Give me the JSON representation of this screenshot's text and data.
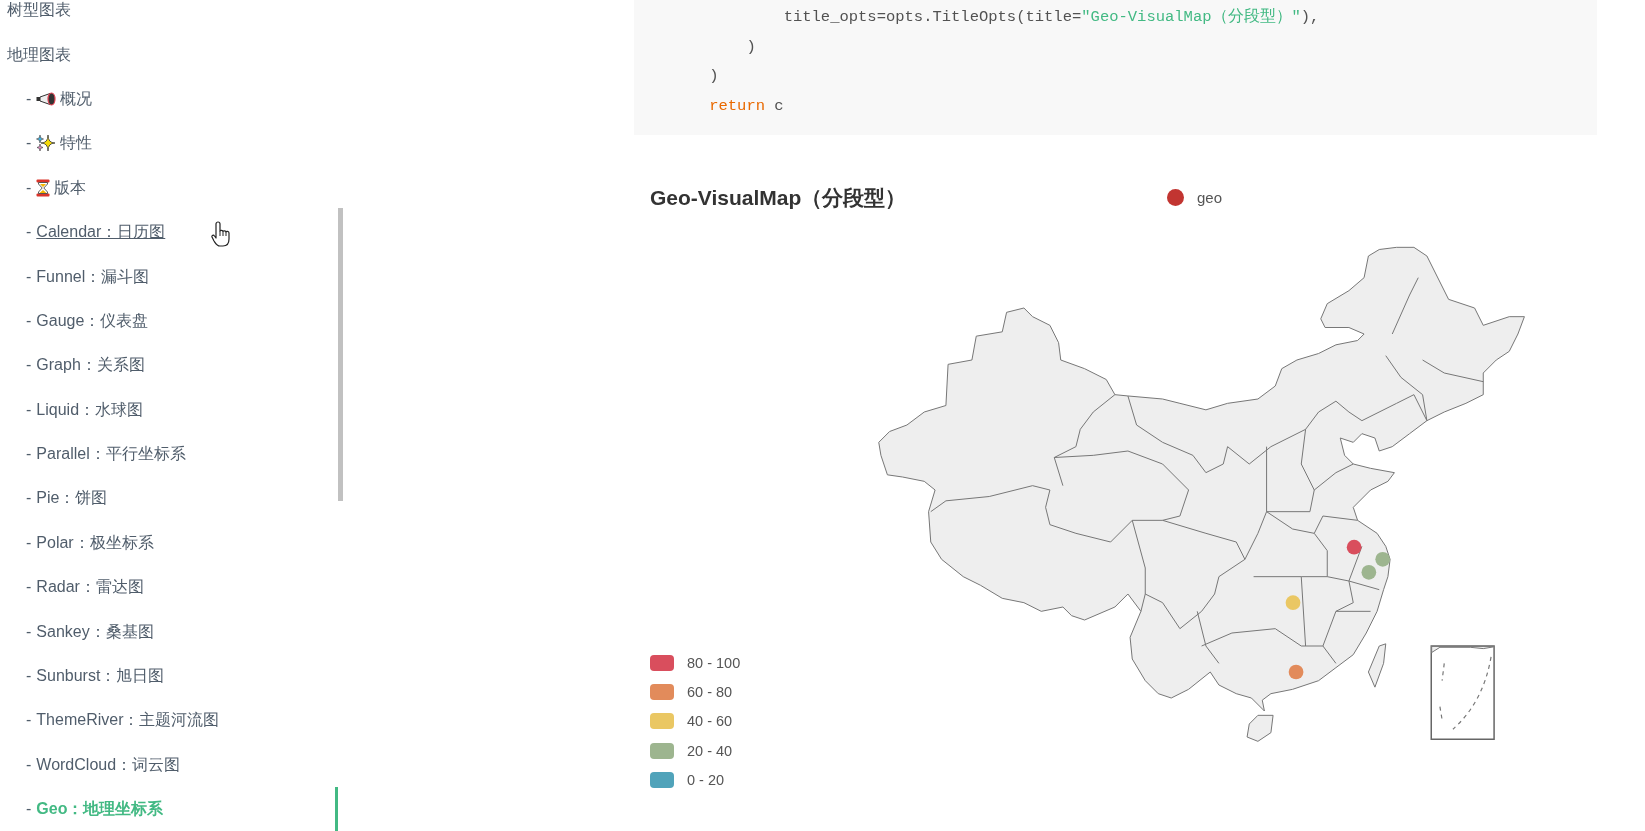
{
  "sidebar": {
    "sections": [
      {
        "title": "树型图表"
      },
      {
        "title": "地理图表",
        "children": [
          {
            "kind": "megaphone",
            "bullet": "-",
            "label": "概况",
            "hovered": false,
            "selected": false
          },
          {
            "kind": "sparkles",
            "bullet": "-",
            "label": "特性",
            "hovered": false,
            "selected": false
          },
          {
            "kind": "hourglass",
            "bullet": "-",
            "label": "版本",
            "hovered": false,
            "selected": false
          },
          {
            "kind": "text",
            "bullet": "-",
            "label": "Calendar：日历图",
            "hovered": true,
            "selected": false
          },
          {
            "kind": "text",
            "bullet": "-",
            "label": "Funnel：漏斗图",
            "hovered": false,
            "selected": false
          },
          {
            "kind": "text",
            "bullet": "-",
            "label": "Gauge：仪表盘",
            "hovered": false,
            "selected": false
          },
          {
            "kind": "text",
            "bullet": "-",
            "label": "Graph：关系图",
            "hovered": false,
            "selected": false
          },
          {
            "kind": "text",
            "bullet": "-",
            "label": "Liquid：水球图",
            "hovered": false,
            "selected": false
          },
          {
            "kind": "text",
            "bullet": "-",
            "label": "Parallel：平行坐标系",
            "hovered": false,
            "selected": false
          },
          {
            "kind": "text",
            "bullet": "-",
            "label": "Pie：饼图",
            "hovered": false,
            "selected": false
          },
          {
            "kind": "text",
            "bullet": "-",
            "label": "Polar：极坐标系",
            "hovered": false,
            "selected": false
          },
          {
            "kind": "text",
            "bullet": "-",
            "label": "Radar：雷达图",
            "hovered": false,
            "selected": false
          },
          {
            "kind": "text",
            "bullet": "-",
            "label": "Sankey：桑基图",
            "hovered": false,
            "selected": false
          },
          {
            "kind": "text",
            "bullet": "-",
            "label": "Sunburst：旭日图",
            "hovered": false,
            "selected": false
          },
          {
            "kind": "text",
            "bullet": "-",
            "label": "ThemeRiver：主题河流图",
            "hovered": false,
            "selected": false
          },
          {
            "kind": "text",
            "bullet": "-",
            "label": "WordCloud：词云图",
            "hovered": false,
            "selected": false
          },
          {
            "kind": "text",
            "bullet": "-",
            "label": "Geo：地理坐标系",
            "hovered": false,
            "selected": true
          }
        ]
      }
    ]
  },
  "code_block": {
    "lines": [
      [
        {
          "kind": "plain",
          "text": "            title_opts=opts.TitleOpts(title="
        },
        {
          "kind": "string",
          "text": "\"Geo-VisualMap（分段型）\""
        },
        {
          "kind": "plain",
          "text": "),"
        }
      ],
      [
        {
          "kind": "plain",
          "text": "        )"
        }
      ],
      [
        {
          "kind": "plain",
          "text": "    )"
        }
      ],
      [
        {
          "kind": "keyword",
          "text": "    return"
        },
        {
          "kind": "plain",
          "text": " c"
        }
      ]
    ]
  },
  "chart": {
    "title": "Geo-VisualMap（分段型）",
    "legend": [
      {
        "label": "geo",
        "color": "#c23531"
      }
    ],
    "visual_map": [
      {
        "label": "80 - 100",
        "color": "#d94e5d"
      },
      {
        "label": "60 - 80",
        "color": "#e28b5b"
      },
      {
        "label": "40 - 60",
        "color": "#eac763"
      },
      {
        "label": "20 - 40",
        "color": "#9db58f"
      },
      {
        "label": "0 - 20",
        "color": "#50a3ba"
      }
    ],
    "markers": [
      {
        "color": "#d94e5d"
      },
      {
        "color": "#9db58f"
      },
      {
        "color": "#9db58f"
      },
      {
        "color": "#eac763"
      },
      {
        "color": "#e28b5b"
      }
    ]
  }
}
